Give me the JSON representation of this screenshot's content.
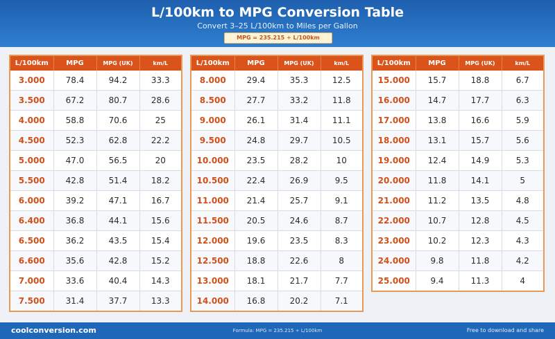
{
  "header": {
    "title": "L/100km to MPG Conversion Table",
    "subtitle": "Convert 3–25 L/100km to Miles per Gallon",
    "formula": "MPG = 235.215 ÷ L/100km"
  },
  "columns": {
    "lkm": "L/100km",
    "mpg": "MPG",
    "mpg_uk": "MPG (UK)",
    "kml": "km/L"
  },
  "panels": [
    {
      "rows": [
        [
          "3.000",
          "78.4",
          "94.2",
          "33.3"
        ],
        [
          "3.500",
          "67.2",
          "80.7",
          "28.6"
        ],
        [
          "4.000",
          "58.8",
          "70.6",
          "25"
        ],
        [
          "4.500",
          "52.3",
          "62.8",
          "22.2"
        ],
        [
          "5.000",
          "47.0",
          "56.5",
          "20"
        ],
        [
          "5.500",
          "42.8",
          "51.4",
          "18.2"
        ],
        [
          "6.000",
          "39.2",
          "47.1",
          "16.7"
        ],
        [
          "6.400",
          "36.8",
          "44.1",
          "15.6"
        ],
        [
          "6.500",
          "36.2",
          "43.5",
          "15.4"
        ],
        [
          "6.600",
          "35.6",
          "42.8",
          "15.2"
        ],
        [
          "7.000",
          "33.6",
          "40.4",
          "14.3"
        ],
        [
          "7.500",
          "31.4",
          "37.7",
          "13.3"
        ]
      ]
    },
    {
      "rows": [
        [
          "8.000",
          "29.4",
          "35.3",
          "12.5"
        ],
        [
          "8.500",
          "27.7",
          "33.2",
          "11.8"
        ],
        [
          "9.000",
          "26.1",
          "31.4",
          "11.1"
        ],
        [
          "9.500",
          "24.8",
          "29.7",
          "10.5"
        ],
        [
          "10.000",
          "23.5",
          "28.2",
          "10"
        ],
        [
          "10.500",
          "22.4",
          "26.9",
          "9.5"
        ],
        [
          "11.000",
          "21.4",
          "25.7",
          "9.1"
        ],
        [
          "11.500",
          "20.5",
          "24.6",
          "8.7"
        ],
        [
          "12.000",
          "19.6",
          "23.5",
          "8.3"
        ],
        [
          "12.500",
          "18.8",
          "22.6",
          "8"
        ],
        [
          "13.000",
          "18.1",
          "21.7",
          "7.7"
        ],
        [
          "14.000",
          "16.8",
          "20.2",
          "7.1"
        ]
      ]
    },
    {
      "rows": [
        [
          "15.000",
          "15.7",
          "18.8",
          "6.7"
        ],
        [
          "16.000",
          "14.7",
          "17.7",
          "6.3"
        ],
        [
          "17.000",
          "13.8",
          "16.6",
          "5.9"
        ],
        [
          "18.000",
          "13.1",
          "15.7",
          "5.6"
        ],
        [
          "19.000",
          "12.4",
          "14.9",
          "5.3"
        ],
        [
          "20.000",
          "11.8",
          "14.1",
          "5"
        ],
        [
          "21.000",
          "11.2",
          "13.5",
          "4.8"
        ],
        [
          "22.000",
          "10.7",
          "12.8",
          "4.5"
        ],
        [
          "23.000",
          "10.2",
          "12.3",
          "4.3"
        ],
        [
          "24.000",
          "9.8",
          "11.8",
          "4.2"
        ],
        [
          "25.000",
          "9.4",
          "11.3",
          "4"
        ]
      ]
    }
  ],
  "footer": {
    "site": "coolconversion.com",
    "formula_note": "Formula: MPG = 235.215 ÷ L/100km",
    "free": "Free to download and share"
  }
}
